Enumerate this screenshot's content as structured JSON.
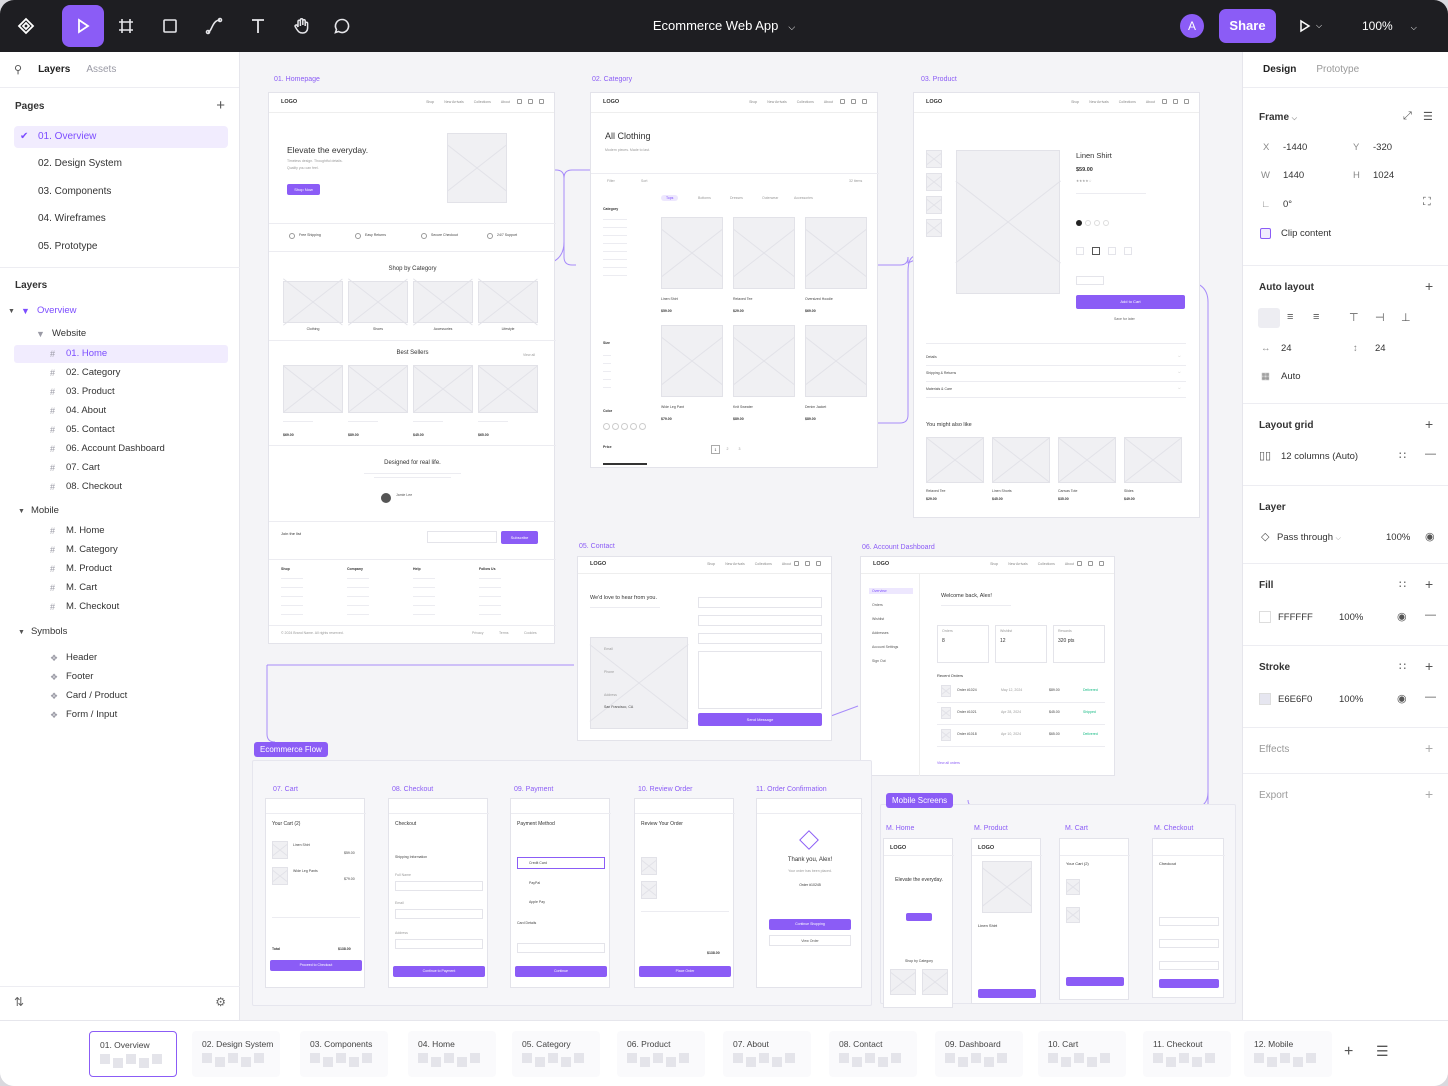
{
  "toolbar": {
    "file_title": "Ecommerce Web App",
    "avatar_initial": "A",
    "share_label": "Share",
    "zoom": "100%",
    "tools": [
      "move-tool",
      "frame-tool",
      "rectangle-tool",
      "pen-tool",
      "text-tool",
      "hand-tool",
      "comment-tool"
    ]
  },
  "left_panel": {
    "tabs": [
      "Layers",
      "Assets"
    ],
    "pages_title": "Pages",
    "pages": [
      "01. Overview",
      "02. Design System",
      "03. Components",
      "04. Wireframes",
      "05. Prototype"
    ],
    "layers_title": "Layers",
    "overview": "Overview",
    "website": "Website",
    "website_items": [
      "01. Home",
      "02. Category",
      "03. Product",
      "04. About",
      "05. Contact",
      "06. Account Dashboard",
      "07. Cart",
      "08. Checkout"
    ],
    "mobile": "Mobile",
    "mobile_items": [
      "M. Home",
      "M. Category",
      "M. Product",
      "M. Cart",
      "M. Checkout"
    ],
    "symbols": "Symbols",
    "symbol_items": [
      "Header",
      "Footer",
      "Card / Product",
      "Form / Input"
    ]
  },
  "canvas": {
    "labels": {
      "home": "01. Homepage",
      "category": "02. Category",
      "product": "03. Product",
      "contact": "05. Contact",
      "account": "06. Account Dashboard",
      "cart": "07. Cart",
      "checkout": "08. Checkout",
      "payment": "09. Payment",
      "review": "10. Review Order",
      "confirmation": "11. Order Confirmation",
      "m_home": "M. Home",
      "m_product": "M. Product",
      "m_cart": "M. Cart",
      "m_checkout": "M. Checkout"
    },
    "badges": {
      "flow": "Ecommerce Flow",
      "mobile": "Mobile Screens"
    },
    "logo": "LOGO",
    "nav_links": [
      "Shop",
      "New Arrivals",
      "Collections",
      "About"
    ],
    "home": {
      "hero_title": "Elevate the everyday.",
      "hero_sub": "Timeless design. Thoughtful details.",
      "hero_sub2": "Quality you can feel.",
      "hero_btn": "Shop Now",
      "features": [
        "Free Shipping",
        "Easy Returns",
        "Secure Checkout",
        "24/7 Support"
      ],
      "shop_by": "Shop by Category",
      "cats": [
        "Clothing",
        "Shoes",
        "Accessories",
        "Lifestyle"
      ],
      "best": "Best Sellers",
      "view_all": "View all",
      "best_prices": [
        "$69.00",
        "$89.00",
        "$45.00",
        "$65.00"
      ],
      "designed": "Designed for real life.",
      "quote_name": "Jamie Lee",
      "join": "Join the list",
      "subscribe": "Subscribe",
      "footer_cols": [
        "Shop",
        "Company",
        "Help",
        "Follow Us"
      ],
      "copyright": "© 2024 Brand Name. All rights reserved.",
      "footer_links": [
        "Privacy",
        "Terms",
        "Cookies"
      ]
    },
    "category": {
      "title": "All Clothing",
      "sub": "Modern pieces. Made to last.",
      "filter": "Filter",
      "sort": "Sort",
      "items_count": "32 items",
      "tabs": [
        "Tops",
        "Bottoms",
        "Dresses",
        "Outerwear",
        "Accessories"
      ],
      "products": [
        {
          "name": "Linen Shirt",
          "price": "$59.00"
        },
        {
          "name": "Relaxed Tee",
          "price": "$29.00"
        },
        {
          "name": "Oversized Hoodie",
          "price": "$69.00"
        },
        {
          "name": "Wide Leg Pant",
          "price": "$79.00"
        },
        {
          "name": "Knit Sweater",
          "price": "$89.00"
        },
        {
          "name": "Denim Jacket",
          "price": "$89.00"
        }
      ],
      "side_heads": [
        "Category",
        "Size",
        "Color",
        "Price"
      ],
      "pagination": [
        "1",
        "2",
        "3"
      ]
    },
    "product": {
      "name": "Linen Shirt",
      "price": "$59.00",
      "add_to_cart": "Add to Cart",
      "save": "Save for later",
      "accordions": [
        "Details",
        "Shipping & Returns",
        "Materials & Care"
      ],
      "also_like": "You might also like",
      "related": [
        {
          "name": "Relaxed Tee",
          "price": "$29.00"
        },
        {
          "name": "Linen Shorts",
          "price": "$45.00"
        },
        {
          "name": "Canvas Tote",
          "price": "$35.00"
        },
        {
          "name": "Slides",
          "price": "$49.00"
        }
      ]
    },
    "contact": {
      "title": "We'd love to hear from you.",
      "info": [
        "Email",
        "Phone",
        "Address"
      ],
      "city": "San Francisco, CA",
      "send": "Send Message"
    },
    "account": {
      "welcome": "Welcome back, Alex!",
      "stats": [
        {
          "label": "Orders",
          "value": "8"
        },
        {
          "label": "Wishlist",
          "value": "12"
        },
        {
          "label": "Rewards",
          "value": "320 pts"
        }
      ],
      "recent": "Recent Orders",
      "orders": [
        {
          "id": "Order #1024",
          "date": "May 12, 2024",
          "amount": "$89.00",
          "status": "Delivered"
        },
        {
          "id": "Order #1021",
          "date": "Apr 28, 2024",
          "amount": "$45.00",
          "status": "Shipped"
        },
        {
          "id": "Order #1018",
          "date": "Apr 10, 2024",
          "amount": "$65.00",
          "status": "Delivered"
        }
      ],
      "view_all": "View all orders",
      "menu": [
        "Overview",
        "Orders",
        "Wishlist",
        "Addresses",
        "Account Settings",
        "Sign Out"
      ]
    },
    "cart": {
      "title": "Your Cart (2)",
      "items": [
        {
          "name": "Linen Shirt",
          "price": "$59.00"
        },
        {
          "name": "Wide Leg Pants",
          "price": "$79.00"
        }
      ],
      "total_label": "Total",
      "total": "$138.00",
      "btn": "Proceed to Checkout"
    },
    "checkout": {
      "title": "Checkout",
      "section": "Shipping Information",
      "fields": [
        "Full Name",
        "Email",
        "Address"
      ],
      "btn": "Continue to Payment"
    },
    "payment": {
      "title": "Payment Method",
      "methods": [
        "Credit Card",
        "PayPal",
        "Apple Pay"
      ],
      "card": "Card Details",
      "btn": "Continue"
    },
    "review": {
      "title": "Review Your Order",
      "total": "$138.00",
      "btn": "Place Order"
    },
    "confirmation": {
      "title": "Thank you, Alex!",
      "sub": "Your order has been placed.",
      "order": "Order #10245",
      "btn": "Continue Shopping",
      "btn2": "View Order"
    },
    "mobile": {
      "hero": "Elevate the everyday.",
      "product": "Linen Shirt",
      "cart": "Your Cart (2)",
      "checkout": "Checkout",
      "shop_by": "Shop by Category"
    }
  },
  "right_panel": {
    "tabs": [
      "Design",
      "Prototype"
    ],
    "frame": "Frame",
    "x_label": "X",
    "x": "-1440",
    "y_label": "Y",
    "y": "-320",
    "w_label": "W",
    "w": "1440",
    "h_label": "H",
    "h": "1024",
    "rotation": "0°",
    "clip": "Clip content",
    "auto_layout": "Auto layout",
    "gap_x": "24",
    "gap_y": "24",
    "auto": "Auto",
    "layout_grid": "Layout grid",
    "grid_value": "12 columns (Auto)",
    "layer": "Layer",
    "pass_through": "Pass through",
    "layer_opacity": "100%",
    "fill": "Fill",
    "fill_hex": "FFFFFF",
    "fill_opacity": "100%",
    "stroke": "Stroke",
    "stroke_hex": "E6E6F0",
    "stroke_opacity": "100%",
    "effects": "Effects",
    "export": "Export"
  },
  "pages_strip": [
    "01. Overview",
    "02. Design System",
    "03. Components",
    "04. Home",
    "05. Category",
    "06. Product",
    "07. About",
    "08. Contact",
    "09. Dashboard",
    "10. Cart",
    "11. Checkout",
    "12. Mobile"
  ],
  "colors": {
    "accent": "#8b5cf6",
    "toolbar": "#1e1e22",
    "canvas": "#f4f4f7"
  }
}
